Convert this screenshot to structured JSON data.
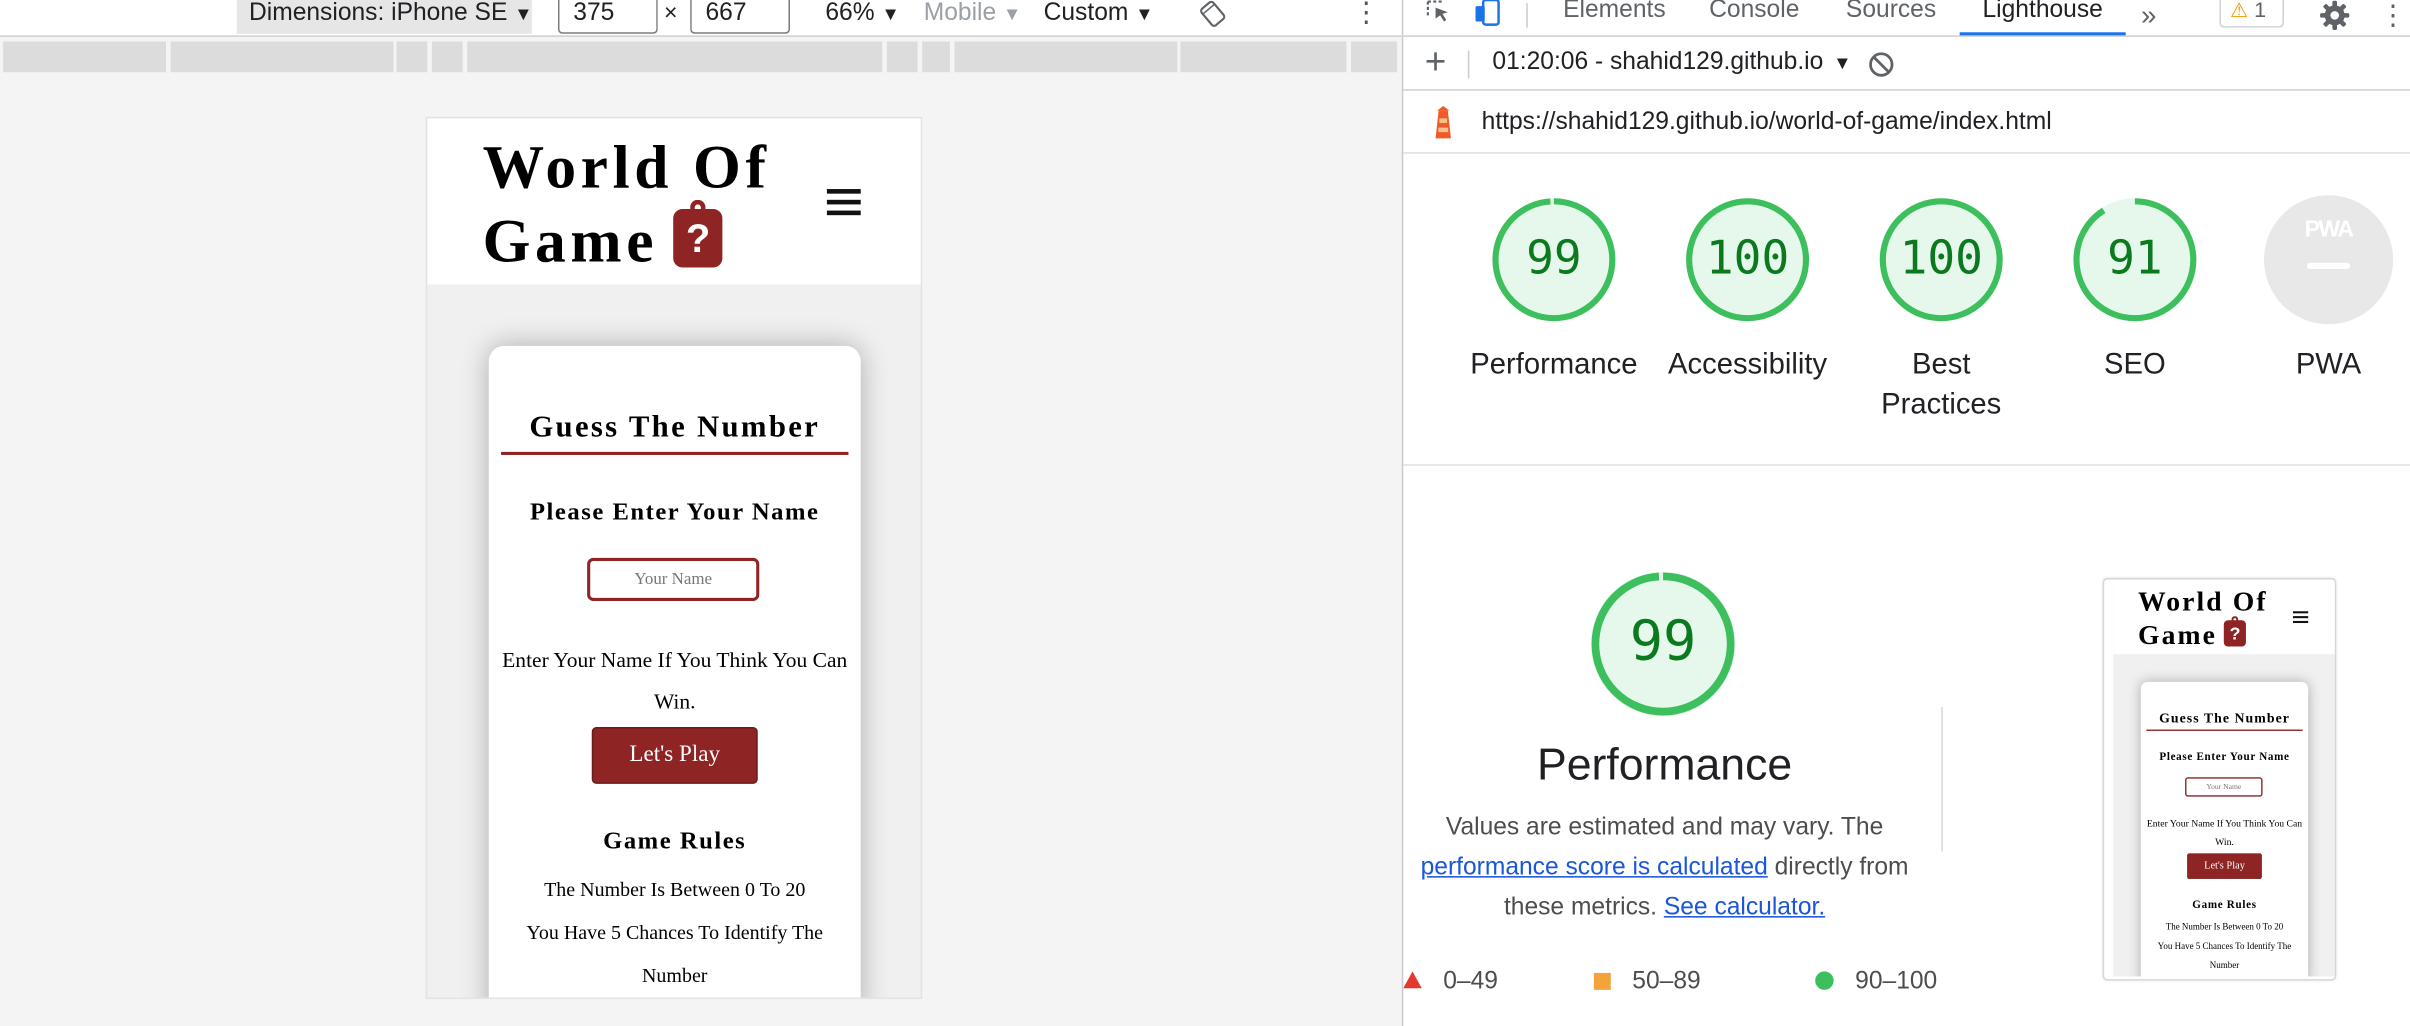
{
  "device_toolbar": {
    "dimensions_label": "Dimensions: iPhone SE",
    "width_value": "375",
    "times_symbol": "×",
    "height_value": "667",
    "zoom_label": "66%",
    "mode_label": "Mobile",
    "throttle_label": "Custom",
    "caret": "▼",
    "menu_glyph": "⋮"
  },
  "site": {
    "title_line1": "World Of",
    "title_line2": "Game",
    "title_icon_glyph": "?",
    "card_title": "Guess The Number",
    "name_heading": "Please Enter Your Name",
    "name_placeholder": "Your Name",
    "prompt_text": "Enter Your Name If You Think You Can Win.",
    "play_button": "Let's Play",
    "rules_heading": "Game Rules",
    "rules": [
      "The Number Is Between 0 To 20",
      "You Have 5 Chances To Identify The Number"
    ]
  },
  "devtools": {
    "tabs": {
      "elements": "Elements",
      "console": "Console",
      "sources": "Sources",
      "lighthouse": "Lighthouse",
      "more": "»"
    },
    "issues_count": "1",
    "issues_glyph": "⚠",
    "menu_glyph": "⋮",
    "new_report_glyph": "+",
    "report_select": "01:20:06 - shahid129.github.io",
    "report_caret": "▼",
    "report_url": "https://shahid129.github.io/world-of-game/index.html"
  },
  "lighthouse": {
    "scores": [
      {
        "name": "Performance",
        "score": 99
      },
      {
        "name": "Accessibility",
        "score": 100
      },
      {
        "name": "Best Practices",
        "score": 100
      },
      {
        "name": "SEO",
        "score": 91
      }
    ],
    "pwa_label": "PWA",
    "pwa_badge_text": "PWA",
    "performance": {
      "score": "99",
      "title": "Performance",
      "desc_prefix": "Values are estimated and may vary. The ",
      "desc_link1": "performance score is calculated",
      "desc_mid": " directly from these metrics. ",
      "desc_link2": "See calculator."
    },
    "legend": {
      "fail": "0–49",
      "average": "50–89",
      "pass": "90–100"
    },
    "colors": {
      "pass": "#0cce6b",
      "pass_text": "#0b7a1f",
      "average": "#ffa400",
      "fail": "#ff4e42"
    }
  }
}
